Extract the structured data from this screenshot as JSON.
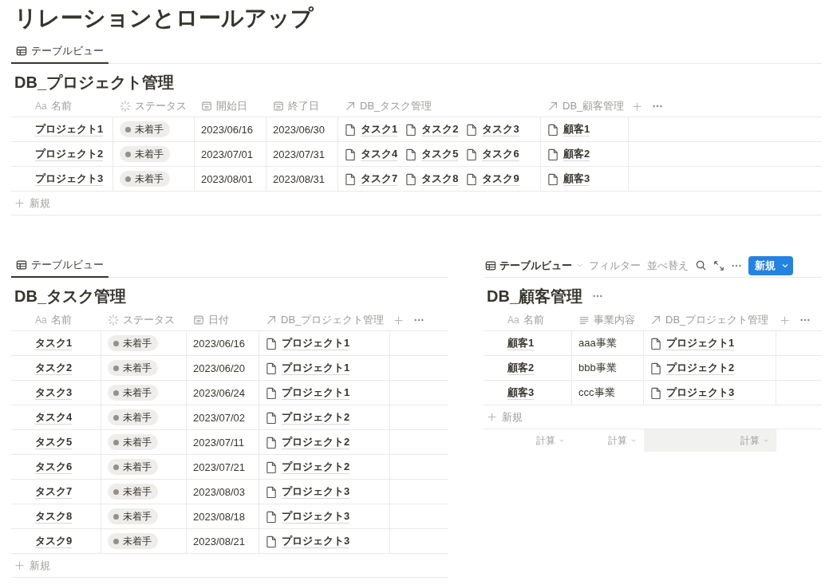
{
  "page": {
    "title": "リレーションとロールアップ"
  },
  "databases": [
    {
      "view": {
        "kind": "tab",
        "label": "テーブルビュー",
        "selected": true
      },
      "title": "DB_プロジェクト管理",
      "columns": [
        {
          "kind": "title",
          "prefix": "Aa",
          "label": "名前"
        },
        {
          "kind": "status",
          "label": "ステータス"
        },
        {
          "kind": "date",
          "label": "開始日"
        },
        {
          "kind": "date",
          "label": "終了日"
        },
        {
          "kind": "relation",
          "label": "DB_タスク管理"
        },
        {
          "kind": "relation",
          "label": "DB_顧客管理"
        }
      ],
      "rows": [
        {
          "cells": [
            "プロジェクト1",
            "未着手",
            "2023/06/16",
            "2023/06/30",
            [
              "タスク1",
              "タスク2",
              "タスク3"
            ],
            [
              "顧客1"
            ]
          ]
        },
        {
          "cells": [
            "プロジェクト2",
            "未着手",
            "2023/07/01",
            "2023/07/31",
            [
              "タスク4",
              "タスク5",
              "タスク6"
            ],
            [
              "顧客2"
            ]
          ]
        },
        {
          "cells": [
            "プロジェクト3",
            "未着手",
            "2023/08/01",
            "2023/08/31",
            [
              "タスク7",
              "タスク8",
              "タスク9"
            ],
            [
              "顧客3"
            ]
          ]
        }
      ],
      "new_row": "新規"
    },
    {
      "view": {
        "kind": "tab",
        "label": "テーブルビュー",
        "selected": true
      },
      "title": "DB_タスク管理",
      "columns": [
        {
          "kind": "title",
          "prefix": "Aa",
          "label": "名前"
        },
        {
          "kind": "status",
          "label": "ステータス"
        },
        {
          "kind": "date",
          "label": "日付"
        },
        {
          "kind": "relation",
          "label": "DB_プロジェクト管理"
        }
      ],
      "rows": [
        {
          "cells": [
            "タスク1",
            "未着手",
            "2023/06/16",
            [
              "プロジェクト1"
            ]
          ]
        },
        {
          "cells": [
            "タスク2",
            "未着手",
            "2023/06/20",
            [
              "プロジェクト1"
            ]
          ]
        },
        {
          "cells": [
            "タスク3",
            "未着手",
            "2023/06/24",
            [
              "プロジェクト1"
            ]
          ]
        },
        {
          "cells": [
            "タスク4",
            "未着手",
            "2023/07/02",
            [
              "プロジェクト2"
            ]
          ]
        },
        {
          "cells": [
            "タスク5",
            "未着手",
            "2023/07/11",
            [
              "プロジェクト2"
            ]
          ]
        },
        {
          "cells": [
            "タスク6",
            "未着手",
            "2023/07/21",
            [
              "プロジェクト2"
            ]
          ]
        },
        {
          "cells": [
            "タスク7",
            "未着手",
            "2023/08/03",
            [
              "プロジェクト3"
            ]
          ]
        },
        {
          "cells": [
            "タスク8",
            "未着手",
            "2023/08/18",
            [
              "プロジェクト3"
            ]
          ]
        },
        {
          "cells": [
            "タスク9",
            "未着手",
            "2023/08/21",
            [
              "プロジェクト3"
            ]
          ]
        }
      ],
      "new_row": "新規"
    },
    {
      "view": {
        "kind": "dropdown",
        "label": "テーブルビュー",
        "actions": [
          "フィルター",
          "並べ替え"
        ],
        "new_button": "新規"
      },
      "title": "DB_顧客管理",
      "title_menu": true,
      "columns": [
        {
          "kind": "title",
          "prefix": "Aa",
          "label": "名前"
        },
        {
          "kind": "text",
          "label": "事業内容"
        },
        {
          "kind": "relation",
          "label": "DB_プロジェクト管理"
        }
      ],
      "rows": [
        {
          "cells": [
            "顧客1",
            "aaa事業",
            [
              "プロジェクト1"
            ]
          ]
        },
        {
          "cells": [
            "顧客2",
            "bbb事業",
            [
              "プロジェクト2"
            ]
          ]
        },
        {
          "cells": [
            "顧客3",
            "ccc事業",
            [
              "プロジェクト3"
            ]
          ]
        }
      ],
      "new_row": "新規",
      "footer": [
        {
          "label": "計算",
          "hovered": false
        },
        {
          "label": "計算",
          "hovered": false
        },
        {
          "label": "計算",
          "hovered": true
        }
      ]
    }
  ]
}
